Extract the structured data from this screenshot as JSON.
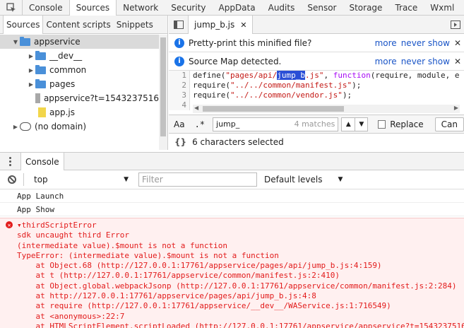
{
  "top_tabs": [
    "Console",
    "Sources",
    "Network",
    "Security",
    "AppData",
    "Audits",
    "Sensor",
    "Storage",
    "Trace",
    "Wxml"
  ],
  "active_top_tab": "Sources",
  "navigator": {
    "tabs": [
      "Sources",
      "Content scripts",
      "Snippets"
    ],
    "tree": [
      {
        "label": "appservice",
        "type": "folder",
        "indent": 1,
        "expanded": true,
        "selected": true
      },
      {
        "label": "__dev__",
        "type": "folder",
        "indent": 2,
        "expanded": false
      },
      {
        "label": "common",
        "type": "folder",
        "indent": 2,
        "expanded": false
      },
      {
        "label": "pages",
        "type": "folder",
        "indent": 2,
        "expanded": false
      },
      {
        "label": "appservice?t=1543237516",
        "type": "file-gray",
        "indent": 3
      },
      {
        "label": "app.js",
        "type": "file-yellow",
        "indent": 3
      },
      {
        "label": "(no domain)",
        "type": "cloud",
        "indent": 1,
        "expanded": false
      }
    ]
  },
  "editor": {
    "file_tab": "jump_b.js",
    "infobars": [
      {
        "message": "Pretty-print this minified file?",
        "more": "more",
        "never": "never show"
      },
      {
        "message": "Source Map detected.",
        "more": "more",
        "never": "never show"
      }
    ],
    "lines": [
      {
        "num": "1",
        "pre": "define(",
        "s1": "\"pages/api/",
        "hl": "jump_b",
        "s2": ".js\"",
        "post1": ", ",
        "kw": "function",
        "post2": "(require, module, e"
      },
      {
        "num": "2",
        "pre": "require(",
        "s1": "\"../../common/manifest.js\"",
        "post1": ");"
      },
      {
        "num": "3",
        "pre": "require(",
        "s1": "\"../../common/vendor.js\"",
        "post1": ");"
      },
      {
        "num": "4",
        "pre": ""
      }
    ],
    "search": {
      "case_label": "Aa",
      "regex_label": ".*",
      "value": "jump_",
      "matches": "4 matches",
      "replace_label": "Replace",
      "cancel_label": "Can"
    },
    "status": "6 characters selected"
  },
  "console": {
    "tab": "Console",
    "context": "top",
    "filter_placeholder": "Filter",
    "levels": "Default levels",
    "messages": [
      "App Launch",
      "App Show"
    ],
    "error_lines": [
      "▾thirdScriptError",
      "sdk uncaught third Error",
      "(intermediate value).$mount is not a function",
      "TypeError: (intermediate value).$mount is not a function",
      "    at Object.68 (http://127.0.0.1:17761/appservice/pages/api/jump_b.js:4:159)",
      "    at t (http://127.0.0.1:17761/appservice/common/manifest.js:2:410)",
      "    at Object.global.webpackJsonp (http://127.0.0.1:17761/appservice/common/manifest.js:2:284)",
      "    at http://127.0.0.1:17761/appservice/pages/api/jump_b.js:4:8",
      "    at require (http://127.0.0.1:17761/appservice/__dev__/WAService.js:1:716549)",
      "    at <anonymous>:22:7",
      "    at HTMLScriptElement.scriptLoaded (http://127.0.0.1:17761/appservice/appservice?t=1543237516"
    ]
  }
}
